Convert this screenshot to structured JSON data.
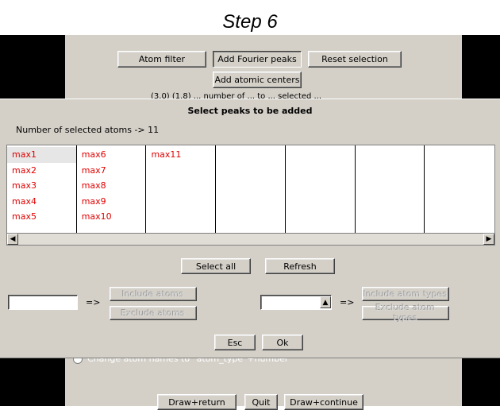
{
  "step_title": "Step 6",
  "top_panel": {
    "atom_filter": "Atom filter",
    "add_fourier_peaks": "Add Fourier peaks",
    "reset_selection": "Reset selection",
    "add_atomic_centers": "Add atomic centers",
    "partial_hidden_text": "(3.0) (1.8) ... number of ... to ... selected ..."
  },
  "dialog": {
    "title": "Select peaks to be added",
    "count_label": "Number of selected atoms -> 11",
    "peak_columns": [
      [
        "max1",
        "max2",
        "max3",
        "max4",
        "max5"
      ],
      [
        "max6",
        "max7",
        "max8",
        "max9",
        "max10"
      ],
      [
        "max11"
      ],
      [],
      [],
      [],
      []
    ],
    "select_all": "Select all",
    "refresh": "Refresh",
    "include_atoms": "Include atoms",
    "exclude_atoms": "Exclude atoms",
    "include_atom_types": "Include atom types",
    "exclude_atom_types": "Exclude atom types",
    "arrow_label": "=>",
    "esc": "Esc",
    "ok": "Ok",
    "highlight_color": "#e00000"
  },
  "bottom_panel": {
    "change_names_option": "Change atom names to \"atom_type\"+number",
    "draw_return": "Draw+return",
    "quit": "Quit",
    "draw_continue": "Draw+continue"
  }
}
